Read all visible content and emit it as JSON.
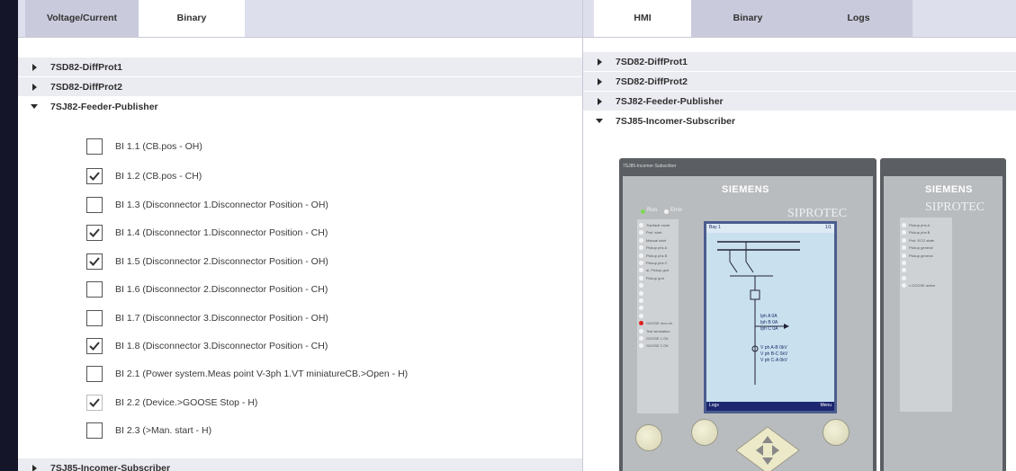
{
  "left_pane": {
    "tabs": [
      {
        "label": "Voltage/Current",
        "active": false
      },
      {
        "label": "Binary",
        "active": true
      }
    ],
    "devices": [
      {
        "name": "7SD82-DiffProt1",
        "expanded": false
      },
      {
        "name": "7SD82-DiffProt2",
        "expanded": false
      },
      {
        "name": "7SJ82-Feeder-Publisher",
        "expanded": true
      }
    ],
    "binary_inputs": [
      {
        "label": "BI 1.1 (CB.pos - OH)",
        "checked": false
      },
      {
        "label": "BI 1.2 (CB.pos - CH)",
        "checked": true
      },
      {
        "label": "BI 1.3 (Disconnector 1.Disconnector Position - OH)",
        "checked": false
      },
      {
        "label": "BI 1.4 (Disconnector 1.Disconnector Position - CH)",
        "checked": true
      },
      {
        "label": "BI 1.5 (Disconnector 2.Disconnector Position - OH)",
        "checked": true
      },
      {
        "label": "BI 1.6 (Disconnector 2.Disconnector Position - CH)",
        "checked": false
      },
      {
        "label": "BI 1.7 (Disconnector 3.Disconnector Position - OH)",
        "checked": false
      },
      {
        "label": "BI 1.8 (Disconnector 3.Disconnector Position - CH)",
        "checked": true
      },
      {
        "label": "BI 2.1 (Power system.Meas point V-3ph 1.VT miniatureCB.>Open - H)",
        "checked": false
      },
      {
        "label": "BI 2.2 (Device.>GOOSE Stop - H)",
        "checked": true
      },
      {
        "label": "BI 2.3 (>Man. start - H)",
        "checked": false
      }
    ],
    "bottom_device": {
      "name": "7SJ85-Incomer-Subscriber",
      "expanded": false
    }
  },
  "right_pane": {
    "tabs": [
      {
        "label": "HMI",
        "active": true
      },
      {
        "label": "Binary",
        "active": false
      },
      {
        "label": "Logs",
        "active": false
      }
    ],
    "devices": [
      {
        "name": "7SD82-DiffProt1",
        "expanded": false
      },
      {
        "name": "7SD82-DiffProt2",
        "expanded": false
      },
      {
        "name": "7SJ82-Feeder-Publisher",
        "expanded": false
      },
      {
        "name": "7SJ85-Incomer-Subscriber",
        "expanded": true
      }
    ],
    "hmi": {
      "window_title": "7SJ85-Incomer-Subscriber",
      "brand": "SIEMENS",
      "product": "SIPROTEC",
      "side_brand": "SIEMENS",
      "side_product": "SIPROTEC",
      "led_run": "Run",
      "led_error": "Error",
      "lcd_title": "Bay 1",
      "lcd_page": "1/1",
      "lcd_values": [
        "Iph A   0A",
        "Iph B   0A",
        "Iph C   0A",
        "V ph A-B   0kV",
        "V ph B-C   0kV",
        "V ph C-A   0kV"
      ],
      "lcd_left_softkey": "Logs",
      "lcd_right_softkey": "Menu",
      "led_labels": [
        "Trip/fault mode",
        "Prot. start",
        "Manual start",
        "Pickup phs A",
        "Pickup phs B",
        "Pickup phs C",
        "ai. Pickup gnd",
        "Pickup gnd",
        "",
        "",
        "",
        "",
        "",
        "GOOSE recv err",
        "Test simulation",
        "GOOSE 1 OK",
        "GOOSE 2 OK"
      ],
      "side_led_labels": [
        "Pickup phs A",
        "Pickup phs B",
        "Prot. ECO state",
        "Pickup general",
        "Pickup general",
        "",
        "",
        "",
        "x GOOSE active"
      ],
      "status_colors": {
        "run_led": "#7ed957",
        "goose_led": "#e0201f"
      }
    }
  }
}
